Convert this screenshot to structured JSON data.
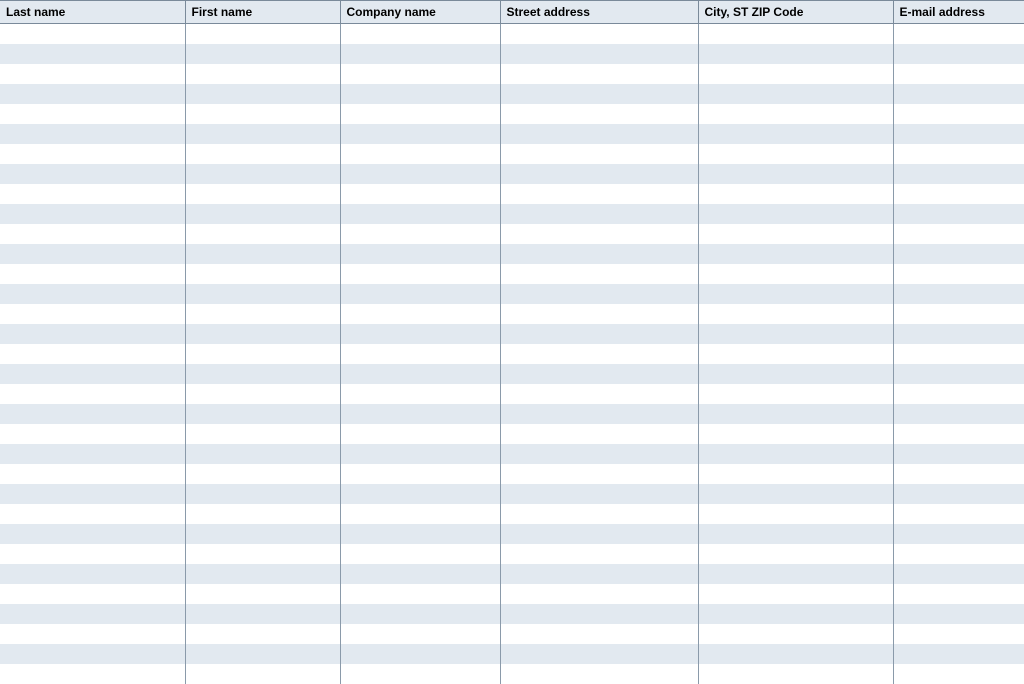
{
  "table": {
    "columns": [
      {
        "label": "Last name"
      },
      {
        "label": "First name"
      },
      {
        "label": "Company name"
      },
      {
        "label": "Street address"
      },
      {
        "label": "City, ST  ZIP Code"
      },
      {
        "label": "E-mail address"
      }
    ],
    "row_count": 33,
    "alt_colors": {
      "odd": "#ffffff",
      "even": "#e2e9f0"
    }
  }
}
